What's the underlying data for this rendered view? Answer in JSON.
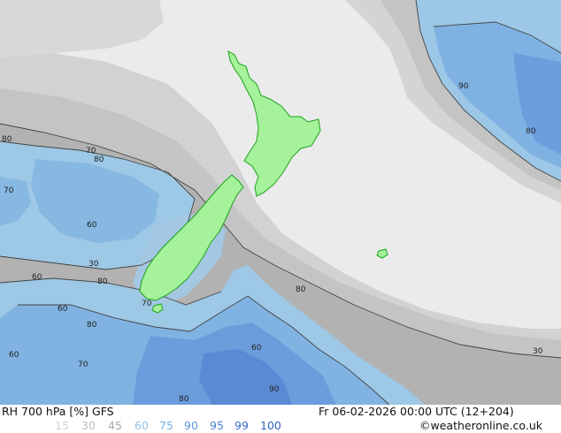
{
  "map": {
    "contour_labels": [
      {
        "text": "90"
      },
      {
        "text": "80"
      },
      {
        "text": "70"
      },
      {
        "text": "80"
      },
      {
        "text": "70"
      },
      {
        "text": "30"
      },
      {
        "text": "60"
      },
      {
        "text": "80"
      },
      {
        "text": "60"
      },
      {
        "text": "80"
      },
      {
        "text": "70"
      },
      {
        "text": "60"
      },
      {
        "text": "80"
      },
      {
        "text": "60"
      },
      {
        "text": "70"
      },
      {
        "text": "60"
      },
      {
        "text": "80"
      },
      {
        "text": "80"
      },
      {
        "text": "90"
      },
      {
        "text": "30"
      }
    ],
    "colors": {
      "sea_background": "#ebebeb",
      "land": "#a6f29b",
      "coast": "#19a319",
      "contour": "#444444"
    }
  },
  "footer": {
    "title": "RH 700 hPa [%] GFS",
    "datetime": "Fr 06-02-2026 00:00 UTC (12+204)",
    "credit": "©weatheronline.co.uk"
  },
  "legend": [
    {
      "label": "15",
      "color": "#d2d2d2"
    },
    {
      "label": "30",
      "color": "#bebebe"
    },
    {
      "label": "45",
      "color": "#a9a9a9"
    },
    {
      "label": "60",
      "color": "#8ec3e4"
    },
    {
      "label": "75",
      "color": "#73aede"
    },
    {
      "label": "90",
      "color": "#5f96d6"
    },
    {
      "label": "95",
      "color": "#4b7fcf"
    },
    {
      "label": "99",
      "color": "#3b6cc6"
    },
    {
      "label": "100",
      "color": "#2f5fc0"
    }
  ]
}
